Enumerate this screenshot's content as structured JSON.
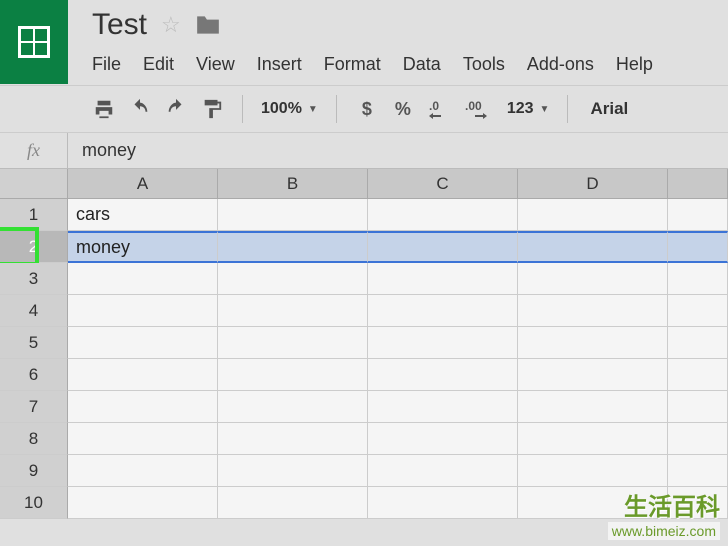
{
  "doc": {
    "title": "Test"
  },
  "menu": {
    "file": "File",
    "edit": "Edit",
    "view": "View",
    "insert": "Insert",
    "format": "Format",
    "data": "Data",
    "tools": "Tools",
    "addons": "Add-ons",
    "help": "Help"
  },
  "toolbar": {
    "zoom": "100%",
    "currency": "$",
    "percent": "%",
    "dec_dec": ".0",
    "dec_inc": ".00",
    "num_format": "123",
    "font": "Arial"
  },
  "formula": {
    "label": "fx",
    "value": "money"
  },
  "columns": [
    "A",
    "B",
    "C",
    "D"
  ],
  "rows": {
    "r1": "1",
    "r2": "2",
    "r3": "3",
    "r4": "4",
    "r5": "5",
    "r6": "6",
    "r7": "7",
    "r8": "8",
    "r9": "9",
    "r10": "10"
  },
  "cells": {
    "a1": "cars",
    "a2": "money"
  },
  "watermark": {
    "line1": "生活百科",
    "line2": "www.bimeiz.com"
  }
}
